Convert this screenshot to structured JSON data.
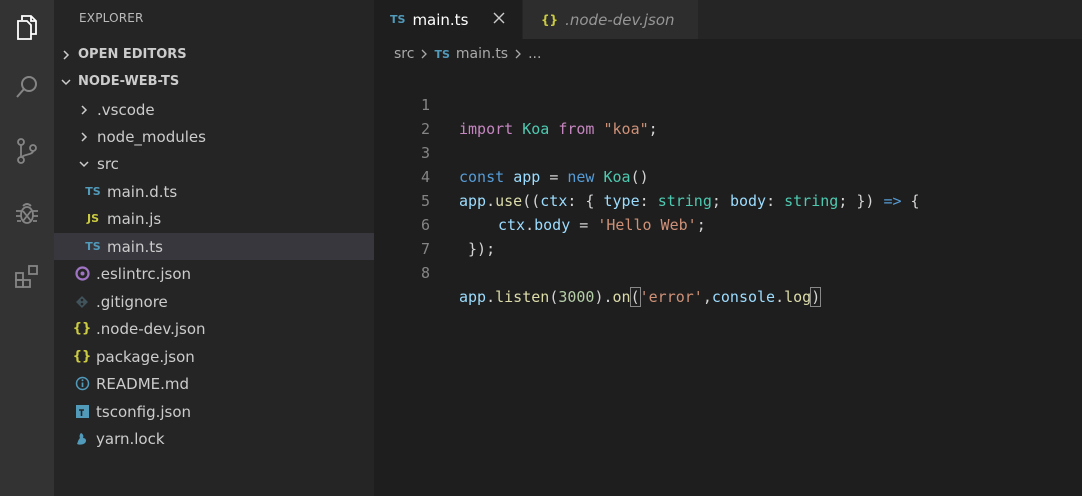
{
  "sidebar": {
    "title": "EXPLORER",
    "sections": {
      "open_editors": "OPEN EDITORS",
      "project": "NODE-WEB-TS"
    },
    "tree": [
      {
        "label": ".vscode",
        "type": "folder",
        "expanded": false,
        "icon": "chevron-right-icon"
      },
      {
        "label": "node_modules",
        "type": "folder",
        "expanded": false,
        "icon": "chevron-right-icon"
      },
      {
        "label": "src",
        "type": "folder",
        "expanded": true,
        "icon": "chevron-down-icon"
      },
      {
        "label": "main.d.ts",
        "type": "ts",
        "badge": "TS"
      },
      {
        "label": "main.js",
        "type": "js",
        "badge": "JS"
      },
      {
        "label": "main.ts",
        "type": "ts",
        "badge": "TS",
        "selected": true
      },
      {
        "label": ".eslintrc.json",
        "type": "eslint",
        "icon": "eslint-icon"
      },
      {
        "label": ".gitignore",
        "type": "git",
        "icon": "git-icon"
      },
      {
        "label": ".node-dev.json",
        "type": "json",
        "badge": "{}"
      },
      {
        "label": "package.json",
        "type": "json",
        "badge": "{}"
      },
      {
        "label": "README.md",
        "type": "info",
        "icon": "info-icon"
      },
      {
        "label": "tsconfig.json",
        "type": "tsconfig",
        "icon": "tsconfig-icon"
      },
      {
        "label": "yarn.lock",
        "type": "yarn",
        "icon": "yarn-icon"
      }
    ]
  },
  "tabs": [
    {
      "label": "main.ts",
      "badge": "TS",
      "active": true
    },
    {
      "label": ".node-dev.json",
      "badge": "{}",
      "active": false
    }
  ],
  "breadcrumb": {
    "folder": "src",
    "file_badge": "TS",
    "file": "main.ts",
    "more": "..."
  },
  "editor": {
    "line_numbers": [
      "1",
      "2",
      "3",
      "4",
      "5",
      "6",
      "7",
      "8"
    ],
    "tokens": {
      "l1": [
        "import",
        "Koa",
        "from",
        "\"koa\"",
        ";"
      ],
      "l3": [
        "const",
        "app",
        "=",
        "new",
        "Koa",
        "()"
      ],
      "l4": [
        "app",
        ".",
        "use",
        "((",
        "ctx",
        ": { ",
        "type",
        ": ",
        "string",
        "; ",
        "body",
        ": ",
        "string",
        "; }) ",
        "=>",
        " {"
      ],
      "l5": [
        "ctx",
        ".",
        "body",
        " = ",
        "'Hello Web'",
        ";"
      ],
      "l6": [
        " });"
      ],
      "l8": [
        "app",
        ".",
        "listen",
        "(",
        "3000",
        ").",
        "on",
        "(",
        "'error'",
        ",",
        "console",
        ".",
        "log",
        ")"
      ]
    }
  },
  "colors": {
    "keyword": "#c586c0",
    "storage": "#569cd6",
    "class": "#4ec9b0",
    "string": "#ce9178",
    "variable": "#9cdcfe",
    "function": "#dcdcaa",
    "number": "#b5cea8",
    "ts_badge": "#519aba",
    "js_badge": "#cbcb41"
  }
}
